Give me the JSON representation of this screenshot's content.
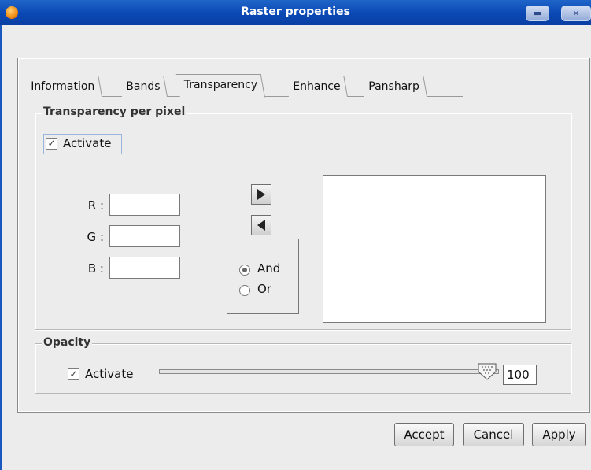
{
  "window": {
    "title": "Raster properties",
    "minimize_glyph": "▬",
    "close_glyph": "×"
  },
  "tabs": [
    {
      "label": "Information"
    },
    {
      "label": "Bands"
    },
    {
      "label": "Transparency",
      "active": true
    },
    {
      "label": "Enhance"
    },
    {
      "label": "Pansharp"
    }
  ],
  "transparency_group": {
    "title": "Transparency per pixel",
    "activate_label": "Activate",
    "activate_checked": true,
    "r_label": "R :",
    "g_label": "G :",
    "b_label": "B :",
    "r_value": "",
    "g_value": "",
    "b_value": "",
    "add_icon": "arrow-right-icon",
    "remove_icon": "arrow-left-icon",
    "logic_options": [
      "And",
      "Or"
    ],
    "logic_selected": "And",
    "pixel_list": []
  },
  "opacity_group": {
    "title": "Opacity",
    "activate_label": "Activate",
    "activate_checked": true,
    "slider_value": 100,
    "value_text": "100"
  },
  "buttons": {
    "accept": "Accept",
    "cancel": "Cancel",
    "apply": "Apply"
  },
  "colors": {
    "titlebar": "#0a48b4",
    "background": "#ececec"
  }
}
